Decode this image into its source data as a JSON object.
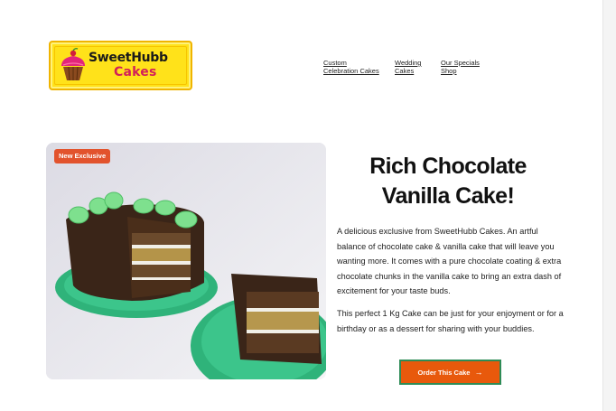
{
  "header": {
    "logo": {
      "line1": "SweetHubb",
      "line2": "Cakes"
    },
    "nav": [
      {
        "label": "Custom\nCelebration Cakes"
      },
      {
        "label": "Wedding\nCakes"
      },
      {
        "label": "Our Specials\nShop"
      }
    ]
  },
  "hero": {
    "badge": "New Exclusive",
    "title": "Rich Chocolate Vanilla Cake!",
    "paragraphs": [
      "A delicious exclusive from SweetHubb Cakes. An artful balance of chocolate cake & vanilla cake that will leave you wanting more. It comes with a pure chocolate coating & extra chocolate chunks in the vanilla cake to bring an extra dash of excitement for your taste buds.",
      "This perfect 1 Kg Cake can be just for your enjoyment or for a birthday or as a dessert for sharing with your buddies."
    ],
    "cta": {
      "label": "Order This Cake",
      "icon": "arrow-right-icon"
    }
  },
  "colors": {
    "logo_bg": "#ffe21a",
    "logo_accent": "#d21f5a",
    "badge_bg": "#e2532d",
    "cta_bg": "#e8590c",
    "cta_border": "#2e8b57"
  }
}
